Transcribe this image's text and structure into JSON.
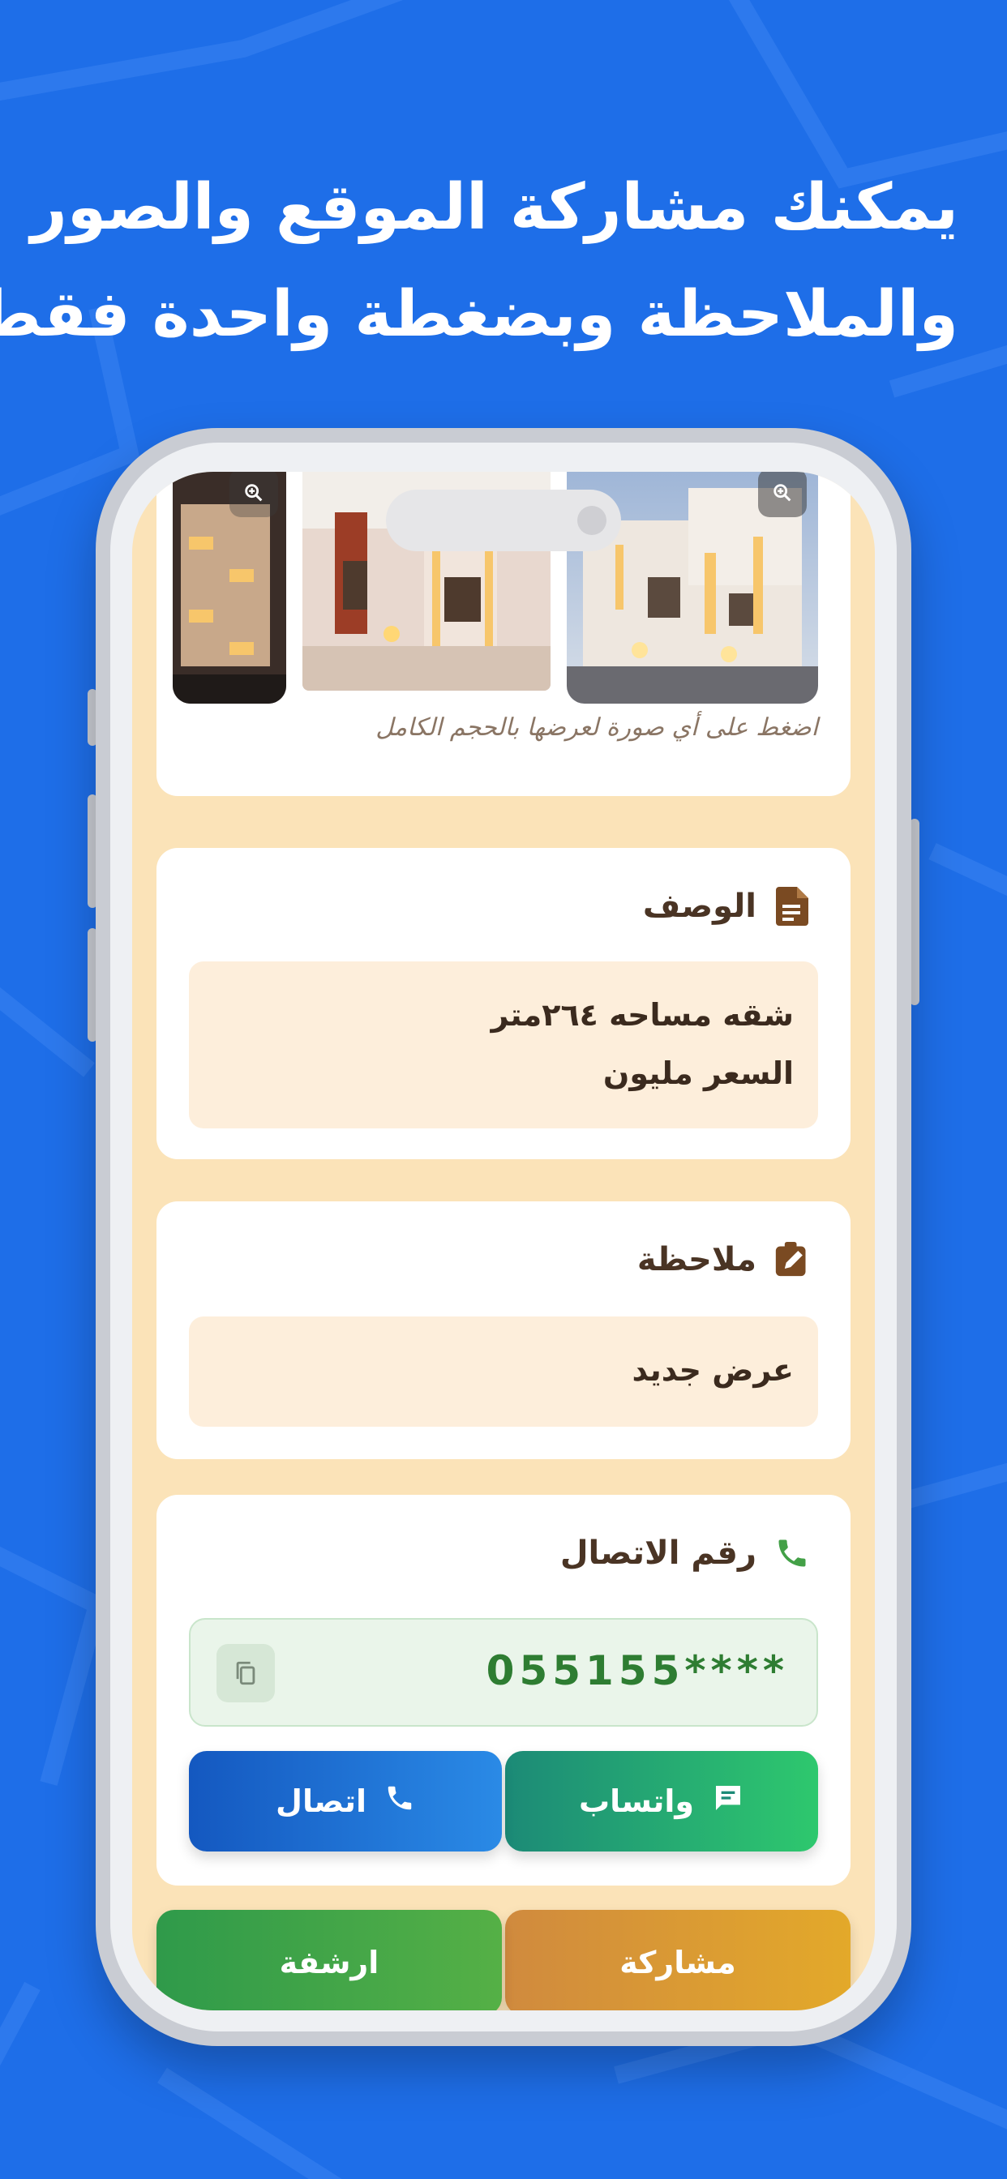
{
  "headline": {
    "line1": "يمكنك مشاركة الموقع والصور",
    "line2": "والملاحظة  وبضغطة واحدة فقط"
  },
  "gallery": {
    "hint": "اضغط على أي صورة لعرضها بالحجم الكامل",
    "zoom_icon": "zoom-in-icon"
  },
  "description": {
    "title": "الوصف",
    "icon": "document-icon",
    "line1": "شقه مساحه ٢٦٤متر",
    "line2": "السعر مليون"
  },
  "note": {
    "title": "ملاحظة",
    "icon": "note-edit-icon",
    "text": "عرض جديد"
  },
  "contact": {
    "title": "رقم الاتصال",
    "icon": "phone-icon",
    "number": "055155****",
    "copy_icon": "copy-icon",
    "whatsapp_label": "واتساب",
    "call_label": "اتصال"
  },
  "bottom": {
    "share_label": "مشاركة",
    "archive_label": "ارشفة"
  },
  "colors": {
    "background": "#1e6ee8",
    "screen_bg": "#fbe3b8",
    "green": "#2e7d32",
    "brown": "#4a3424"
  }
}
